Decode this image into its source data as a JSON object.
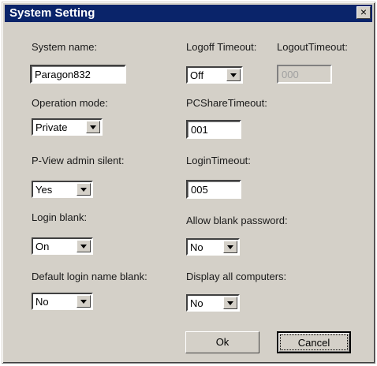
{
  "window": {
    "title": "System Setting",
    "close_glyph": "×"
  },
  "left": {
    "system_name": {
      "label": "System name:",
      "value": "Paragon832"
    },
    "operation_mode": {
      "label": "Operation mode:",
      "value": "Private"
    },
    "pview_admin_silent": {
      "label": "P-View admin silent:",
      "value": "Yes"
    },
    "login_blank": {
      "label": "Login blank:",
      "value": "On"
    },
    "default_login_name_blank": {
      "label": "Default login name blank:",
      "value": "No"
    }
  },
  "right": {
    "logoff_timeout": {
      "label": "Logoff Timeout:",
      "value": "Off"
    },
    "logout_timeout": {
      "label": "LogoutTimeout:",
      "value": "000"
    },
    "pcshare_timeout": {
      "label": "PCShareTimeout:",
      "value": "001"
    },
    "login_timeout": {
      "label": "LoginTimeout:",
      "value": "005"
    },
    "allow_blank_password": {
      "label": "Allow blank password:",
      "value": "No"
    },
    "display_all_computers": {
      "label": "Display all computers:",
      "value": "No"
    }
  },
  "buttons": {
    "ok": "Ok",
    "cancel": "Cancel"
  }
}
